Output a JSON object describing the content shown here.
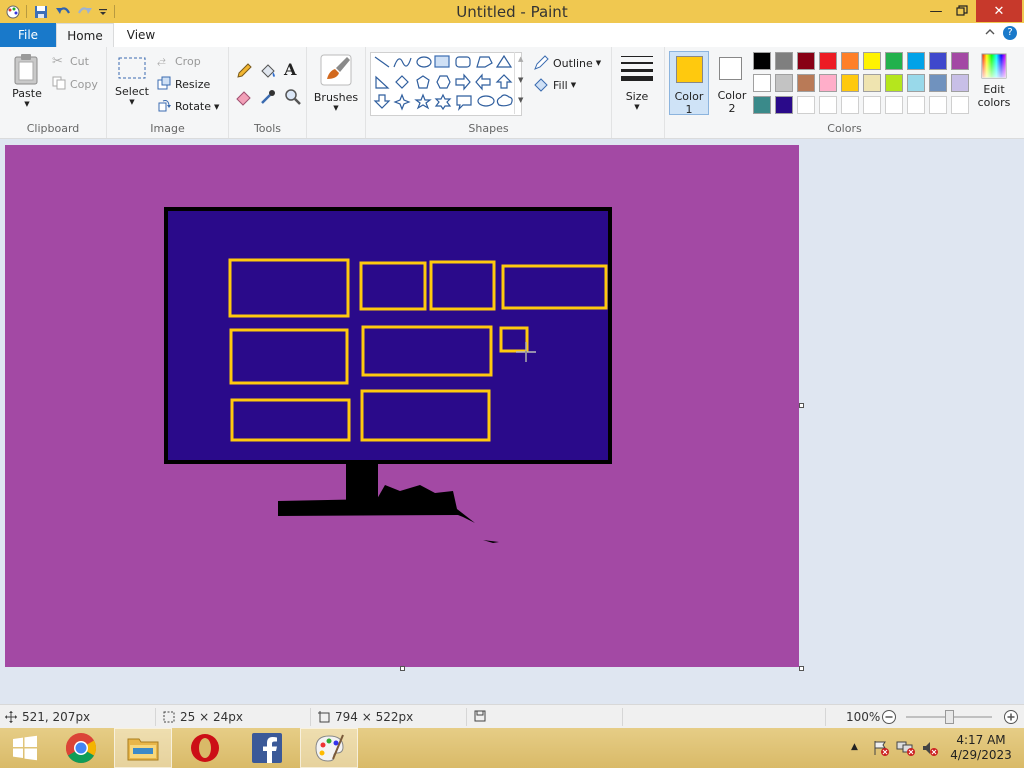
{
  "titlebar": {
    "title": "Untitled - Paint",
    "minimize_icon": "minimize-icon",
    "restore_icon": "restore-icon",
    "close_icon": "close-icon"
  },
  "tabs": {
    "file": "File",
    "home": "Home",
    "view": "View"
  },
  "ribbon": {
    "clipboard": {
      "label": "Clipboard",
      "paste": "Paste",
      "cut": "Cut",
      "copy": "Copy"
    },
    "image": {
      "label": "Image",
      "select": "Select",
      "crop": "Crop",
      "resize": "Resize",
      "rotate": "Rotate"
    },
    "tools": {
      "label": "Tools"
    },
    "brushes": {
      "label": "Brushes"
    },
    "shapes": {
      "label": "Shapes",
      "outline": "Outline",
      "fill": "Fill"
    },
    "size": {
      "label": "Size"
    },
    "color1": {
      "line1": "Color",
      "line2": "1"
    },
    "color2": {
      "line1": "Color",
      "line2": "2"
    },
    "colors": {
      "label": "Colors",
      "edit_line1": "Edit",
      "edit_line2": "colors"
    }
  },
  "palette": {
    "row1": [
      "#000000",
      "#7f7f7f",
      "#880015",
      "#ed1c24",
      "#ff7f27",
      "#fff200",
      "#22b14c",
      "#00a2e8",
      "#3f48cc",
      "#a349a4"
    ],
    "row2": [
      "#ffffff",
      "#c3c3c3",
      "#b97a57",
      "#ffaec9",
      "#ffc90e",
      "#efe4b0",
      "#b5e61d",
      "#99d9ea",
      "#7092be",
      "#c8bfe7"
    ],
    "row3": [
      "#3a8a8a",
      "#2a0a8a",
      "#ffffff",
      "#ffffff",
      "#ffffff",
      "#ffffff",
      "#ffffff",
      "#ffffff",
      "#ffffff",
      "#ffffff"
    ]
  },
  "colors_state": {
    "color1": "#ffc90e",
    "color2": "#ffffff"
  },
  "canvas": {
    "background": "#a349a4",
    "monitor_frame": "#000000",
    "screen_fill": "#2a0a8a",
    "tile_outline": "#ffc90e"
  },
  "status": {
    "cursor_pos": "521, 207px",
    "selection_size": "25 × 24px",
    "image_size": "794 × 522px",
    "zoom": "100%"
  },
  "taskbar": {
    "apps": [
      "windows-start",
      "chrome",
      "file-explorer",
      "opera",
      "facebook",
      "paint"
    ],
    "time": "4:17 AM",
    "date": "4/29/2023"
  }
}
